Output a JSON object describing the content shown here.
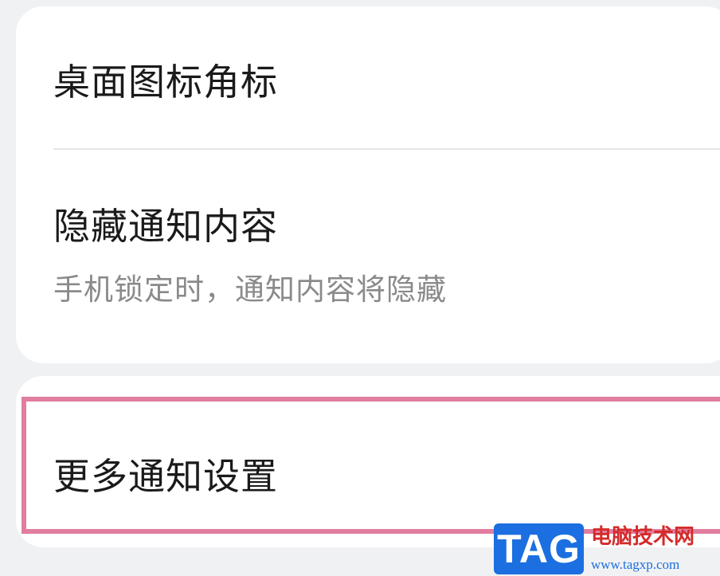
{
  "settings": {
    "badge_row": {
      "title": "桌面图标角标"
    },
    "hide_content_row": {
      "title": "隐藏通知内容",
      "subtitle": "手机锁定时，通知内容将隐藏"
    },
    "more_row": {
      "title": "更多通知设置"
    }
  },
  "watermark": {
    "tag": "TAG",
    "site_name": "电脑技术网",
    "url": "www.tagxp.com"
  },
  "colors": {
    "background": "#f0f1f3",
    "card": "#ffffff",
    "highlight_border": "#e17d9f",
    "watermark_blue": "#1b6fe0",
    "watermark_red": "#d42a2a"
  }
}
